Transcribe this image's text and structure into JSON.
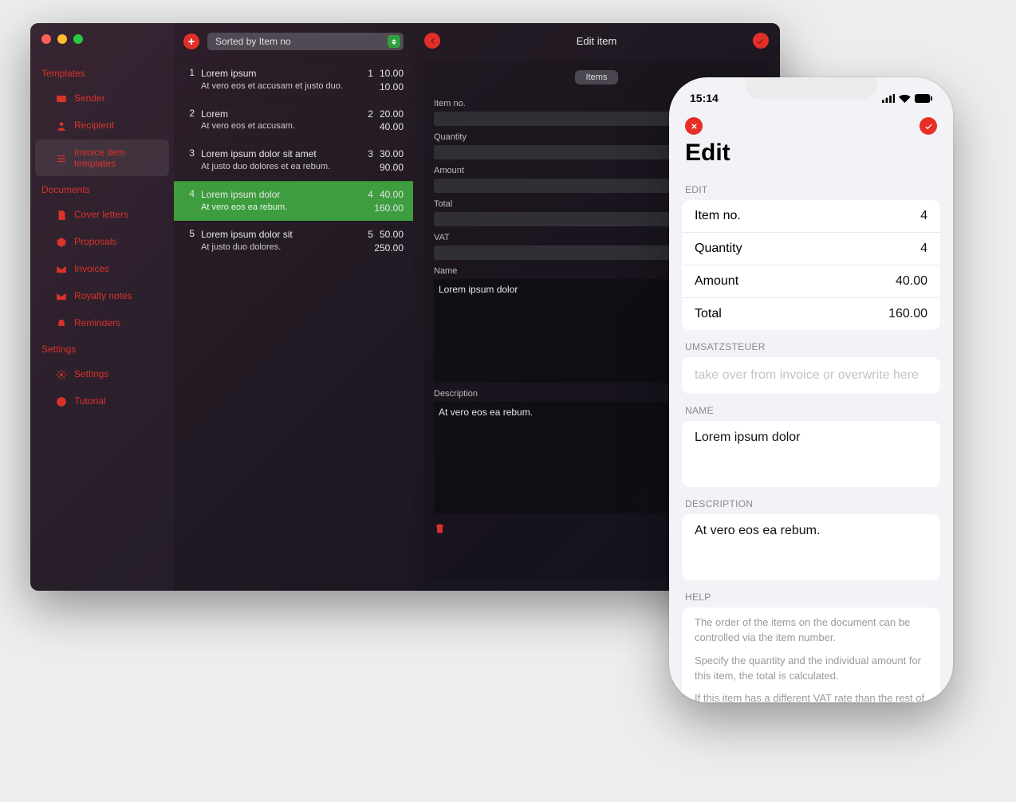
{
  "sidebar": {
    "sections": [
      {
        "title": "Templates",
        "items": [
          {
            "label": "Sender",
            "icon": "contact-card-icon"
          },
          {
            "label": "Recipient",
            "icon": "person-icon"
          },
          {
            "label": "Invoice item templates",
            "icon": "list-icon",
            "selected": true
          }
        ]
      },
      {
        "title": "Documents",
        "items": [
          {
            "label": "Cover letters",
            "icon": "document-icon"
          },
          {
            "label": "Proposals",
            "icon": "proposal-icon"
          },
          {
            "label": "Invoices",
            "icon": "envelope-icon"
          },
          {
            "label": "Royalty notes",
            "icon": "envelope-icon"
          },
          {
            "label": "Reminders",
            "icon": "bell-icon"
          }
        ]
      },
      {
        "title": "Settings",
        "items": [
          {
            "label": "Settings",
            "icon": "gear-icon"
          },
          {
            "label": "Tutorial",
            "icon": "help-icon"
          }
        ]
      }
    ]
  },
  "list": {
    "sort_label": "Sorted by Item no",
    "rows": [
      {
        "idx": "1",
        "title": "Lorem ipsum",
        "sub": "At vero eos et accusam et justo duo.",
        "qty": "1",
        "amount": "10.00",
        "total": "10.00"
      },
      {
        "idx": "2",
        "title": "Lorem",
        "sub": "At vero eos et accusam.",
        "qty": "2",
        "amount": "20.00",
        "total": "40.00"
      },
      {
        "idx": "3",
        "title": "Lorem ipsum dolor sit amet",
        "sub": "At justo duo dolores et ea rebum.",
        "qty": "3",
        "amount": "30.00",
        "total": "90.00"
      },
      {
        "idx": "4",
        "title": "Lorem ipsum dolor",
        "sub": "At vero eos ea rebum.",
        "qty": "4",
        "amount": "40.00",
        "total": "160.00",
        "selected": true
      },
      {
        "idx": "5",
        "title": "Lorem ipsum dolor sit",
        "sub": "At justo duo dolores.",
        "qty": "5",
        "amount": "50.00",
        "total": "250.00"
      }
    ]
  },
  "detail": {
    "title": "Edit item",
    "tab": "Items",
    "labels": {
      "item_no": "Item no.",
      "quantity": "Quantity",
      "amount": "Amount",
      "total": "Total",
      "vat": "VAT",
      "name": "Name",
      "description": "Description"
    },
    "values": {
      "name": "Lorem ipsum dolor",
      "description": "At vero eos ea rebum."
    }
  },
  "ios": {
    "status_time": "15:14",
    "title": "Edit",
    "section_edit": "EDIT",
    "rows": [
      {
        "label": "Item no.",
        "value": "4"
      },
      {
        "label": "Quantity",
        "value": "4"
      },
      {
        "label": "Amount",
        "value": "40.00"
      },
      {
        "label": "Total",
        "value": "160.00"
      }
    ],
    "section_vat": "UMSATZSTEUER",
    "vat_placeholder": "take over from invoice or overwrite here",
    "section_name": "NAME",
    "name_value": "Lorem ipsum dolor",
    "section_desc": "DESCRIPTION",
    "desc_value": "At vero eos ea rebum.",
    "section_help": "HELP",
    "help_p1": "The order of the items on the document can be controlled via the item number.",
    "help_p2": "Specify the quantity and the individual amount for this item, the total is calculated.",
    "help_p3": "If this item has a different VAT rate than the rest of the invoice, you can enter one for this item here. Otherwise the VAT rate will be taken from the invoice."
  }
}
